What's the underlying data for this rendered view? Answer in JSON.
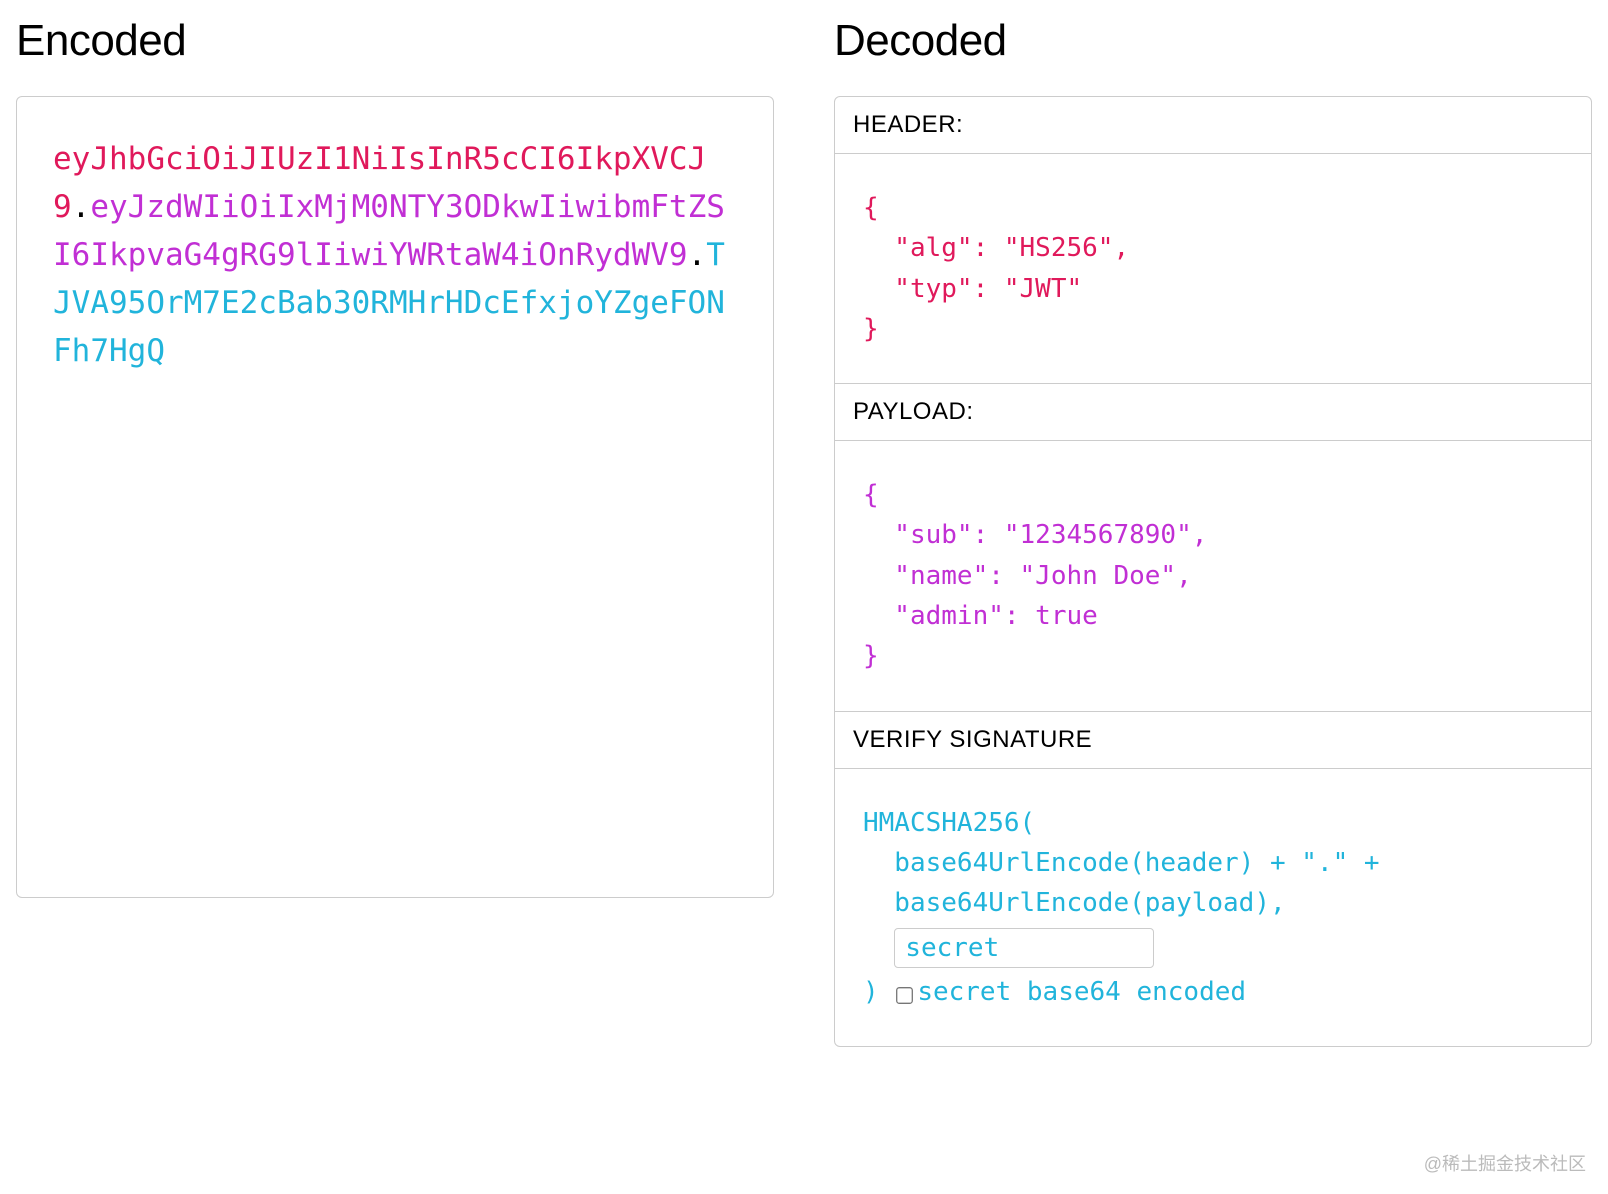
{
  "encoded": {
    "title": "Encoded",
    "header_segment": "eyJhbGciOiJIUzI1NiIsInR5cCI6IkpXVCJ9",
    "payload_segment": "eyJzdWIiOiIxMjM0NTY3ODkwIiwibmFtZSI6IkpvaG4gRG9lIiwiYWRtaW4iOnRydWV9",
    "signature_segment": "TJVA95OrM7E2cBab30RMHrHDcEfxjoYZgeFONFh7HgQ"
  },
  "decoded": {
    "title": "Decoded",
    "header_label": "HEADER:",
    "header_json": "{\n  \"alg\": \"HS256\",\n  \"typ\": \"JWT\"\n}",
    "payload_label": "PAYLOAD:",
    "payload_json": "{\n  \"sub\": \"1234567890\",\n  \"name\": \"John Doe\",\n  \"admin\": true\n}",
    "signature_label": "VERIFY SIGNATURE",
    "sig_line1": "HMACSHA256(",
    "sig_line2": "  base64UrlEncode(header) + \".\" +",
    "sig_line3": "  base64UrlEncode(payload),",
    "sig_secret_value": "secret",
    "sig_line4": ") ",
    "sig_base64_label": "secret base64 encoded"
  },
  "watermark": "@稀土掘金技术社区"
}
